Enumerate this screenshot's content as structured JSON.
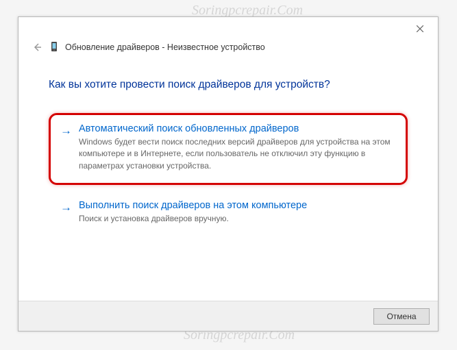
{
  "watermark": "Soringpcrepair.Com",
  "dialog": {
    "title": "Обновление драйверов - Неизвестное устройство",
    "heading": "Как вы хотите провести поиск драйверов для устройств?",
    "options": [
      {
        "title": "Автоматический поиск обновленных драйверов",
        "description": "Windows будет вести поиск последних версий драйверов для устройства на этом компьютере и в Интернете, если пользователь не отключил эту функцию в параметрах установки устройства."
      },
      {
        "title": "Выполнить поиск драйверов на этом компьютере",
        "description": "Поиск и установка драйверов вручную."
      }
    ],
    "footer": {
      "cancel": "Отмена"
    }
  }
}
